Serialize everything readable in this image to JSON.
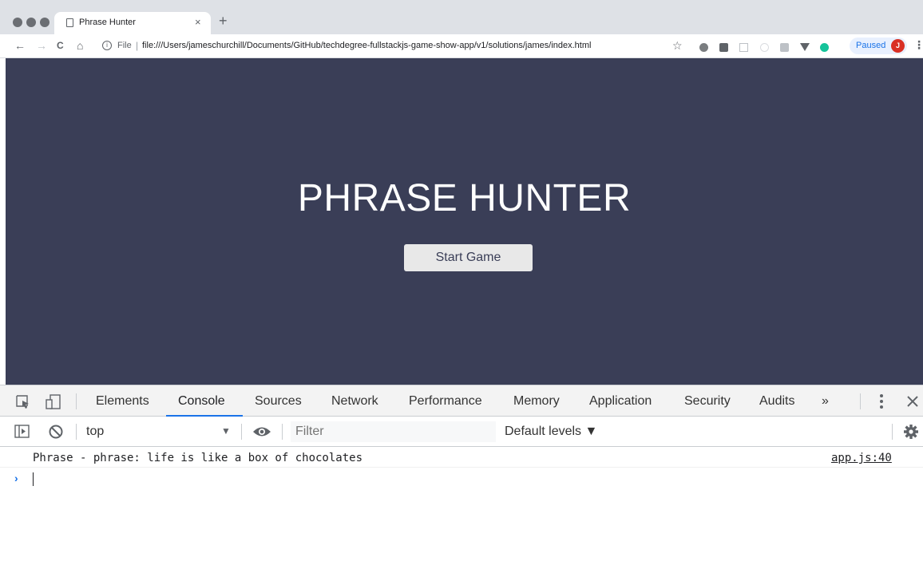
{
  "browser": {
    "tab_title": "Phrase Hunter",
    "tab_close": "×",
    "new_tab": "+",
    "nav": {
      "back": "←",
      "forward": "→",
      "reload": "C",
      "home": "⌂"
    },
    "omnibox": {
      "scheme_label": "File",
      "separator": "|",
      "url": "file:///Users/jameschurchill/Documents/GitHub/techdegree-fullstackjs-game-show-app/v1/solutions/james/index.html"
    },
    "bookmark_star": "☆",
    "profile": {
      "status": "Paused",
      "initial": "J"
    },
    "menu": "⋮"
  },
  "page": {
    "title": "PHRASE HUNTER",
    "start_button": "Start Game",
    "colors": {
      "background": "#3a3e57",
      "button": "#e8e8e8",
      "text": "#ffffff"
    }
  },
  "devtools": {
    "tabs": [
      "Elements",
      "Console",
      "Sources",
      "Network",
      "Performance",
      "Memory",
      "Application",
      "Security",
      "Audits"
    ],
    "active_tab": "Console",
    "more_tabs": "»",
    "context": "top",
    "filter_placeholder": "Filter",
    "levels": "Default levels ▼",
    "console": {
      "message": "Phrase - phrase: life is like a box of chocolates",
      "source": "app.js:40",
      "prompt": "›"
    }
  }
}
